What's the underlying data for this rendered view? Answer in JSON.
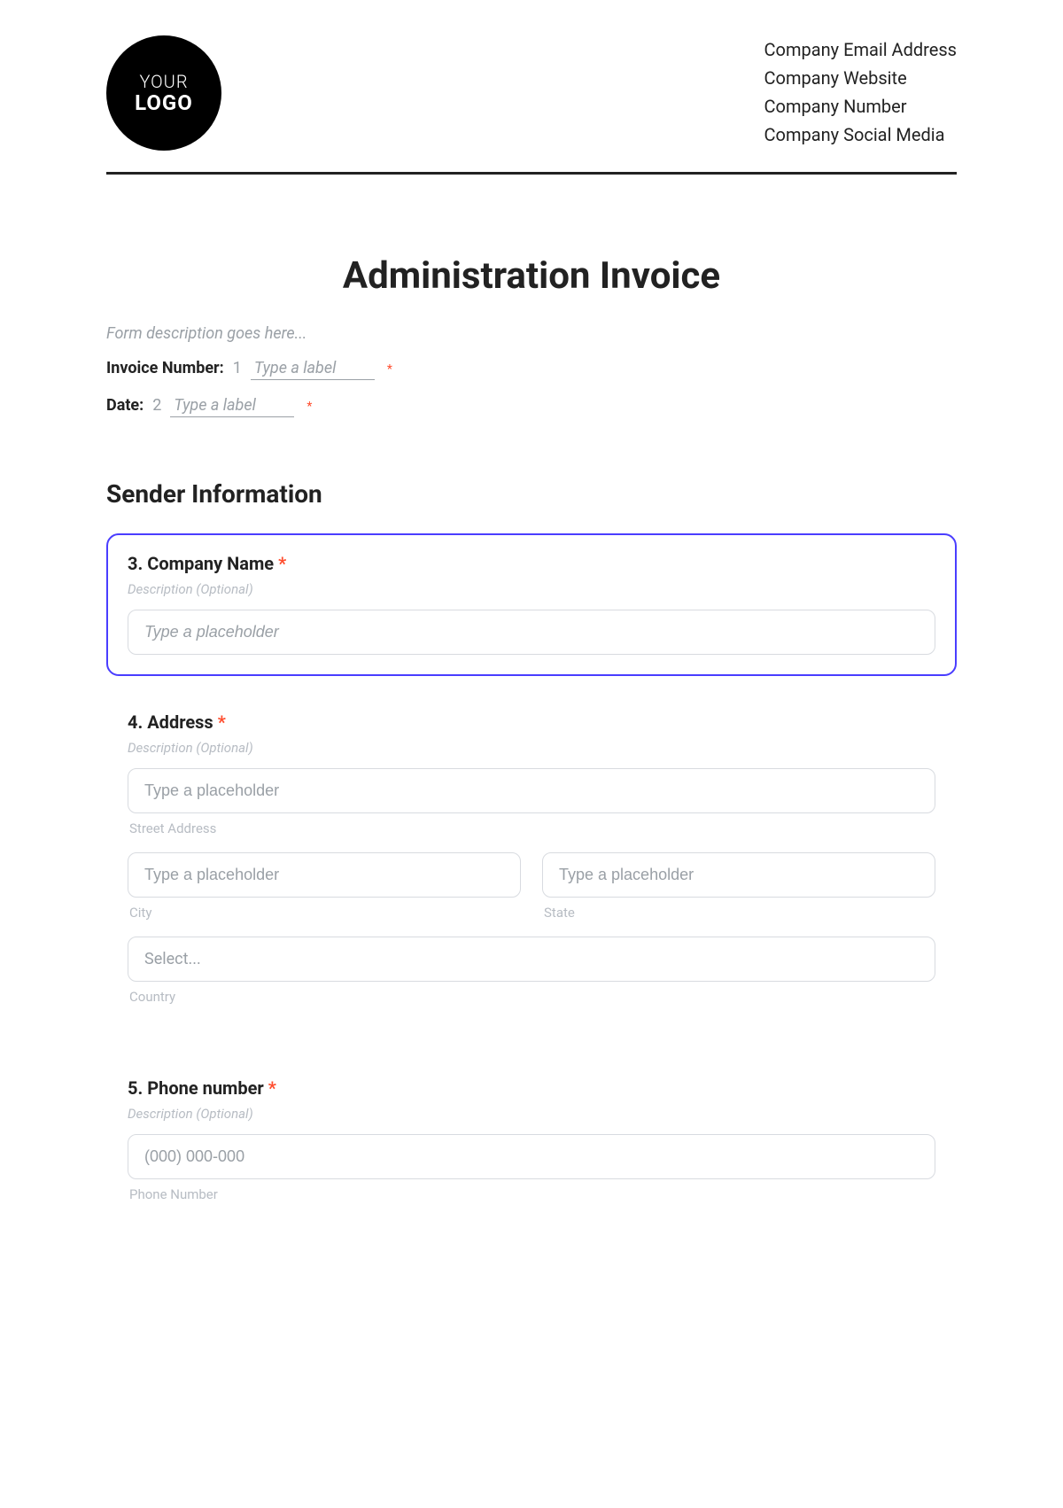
{
  "header": {
    "logo": {
      "line1": "YOUR",
      "line2": "LOGO"
    },
    "company": {
      "email": "Company Email Address",
      "website": "Company Website",
      "number": "Company Number",
      "social": "Company Social Media"
    }
  },
  "title": "Administration Invoice",
  "form_description": "Form description goes here...",
  "inline_fields": {
    "invoice": {
      "label": "Invoice Number:",
      "num": "1",
      "placeholder": "Type a label"
    },
    "date": {
      "label": "Date:",
      "num": "2",
      "placeholder": "Type a label"
    }
  },
  "sections": {
    "sender": {
      "heading": "Sender Information",
      "company_name": {
        "title": "3. Company Name",
        "desc": "Description (Optional)",
        "placeholder": "Type a placeholder"
      },
      "address": {
        "title": "4. Address",
        "desc": "Description (Optional)",
        "street_placeholder": "Type a placeholder",
        "street_label": "Street Address",
        "city_placeholder": "Type a placeholder",
        "city_label": "City",
        "state_placeholder": "Type a placeholder",
        "state_label": "State",
        "country_placeholder": "Select...",
        "country_label": "Country"
      },
      "phone": {
        "title": "5. Phone number",
        "desc": "Description (Optional)",
        "placeholder": "(000) 000-000",
        "sub_label": "Phone Number"
      }
    }
  },
  "required_marker": "*"
}
